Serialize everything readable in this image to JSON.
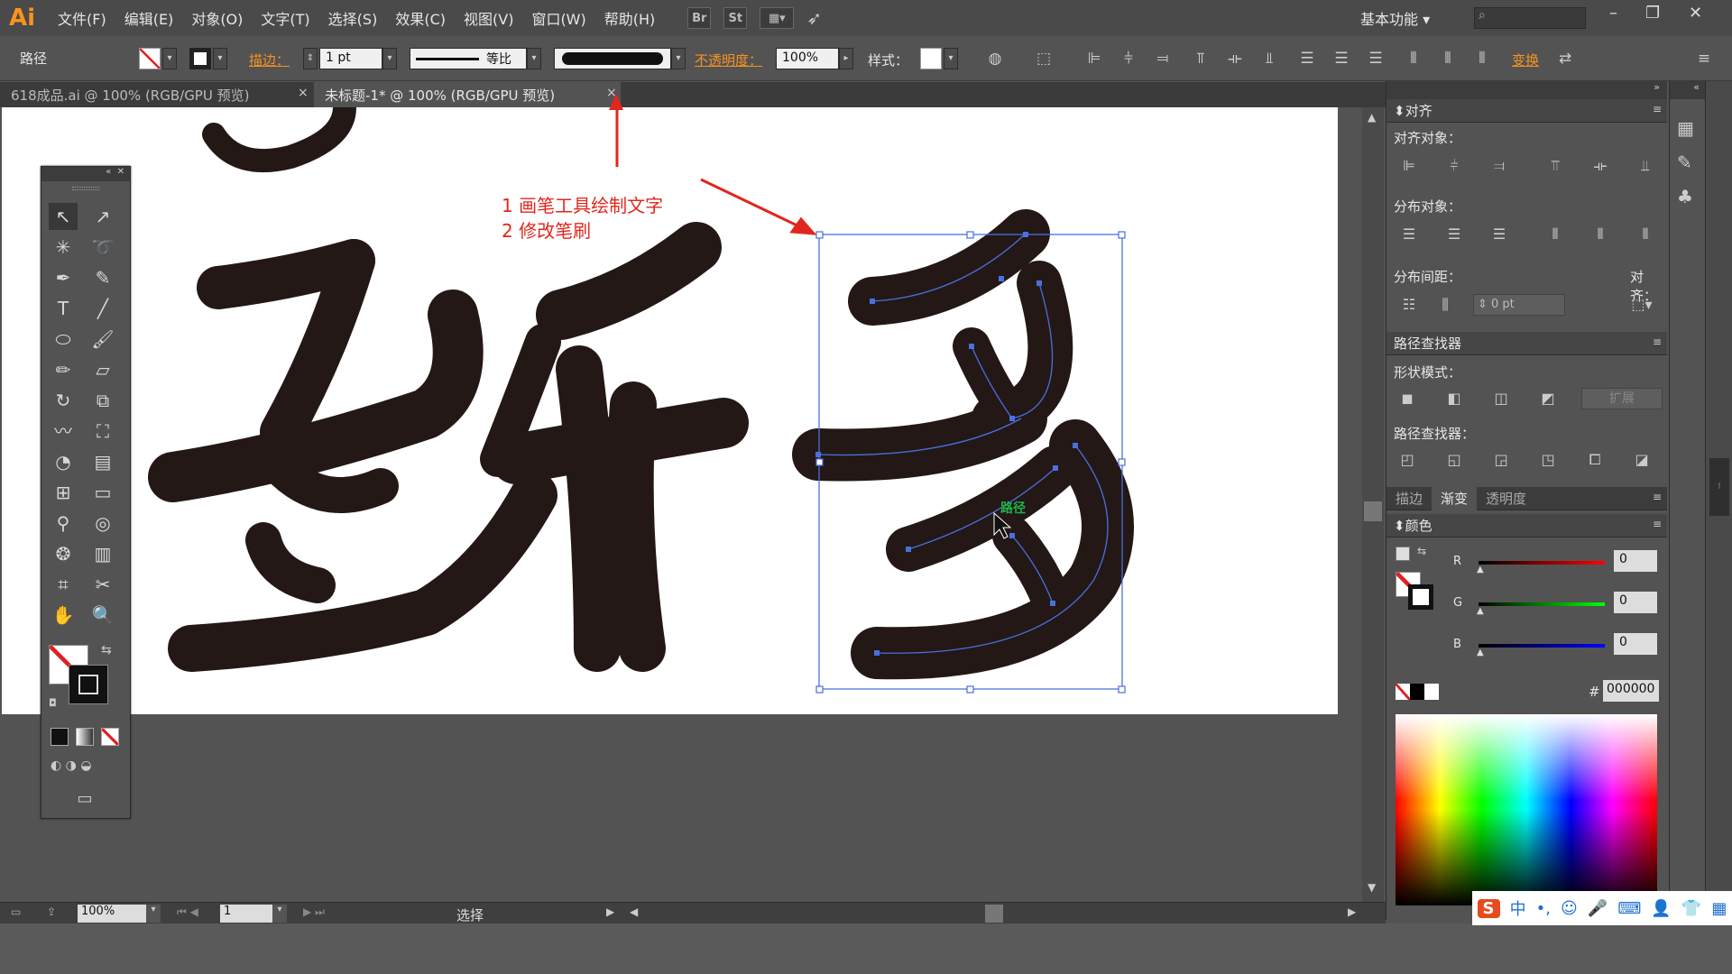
{
  "app": {
    "logo": "Ai"
  },
  "menu": [
    "文件(F)",
    "编辑(E)",
    "对象(O)",
    "文字(T)",
    "选择(S)",
    "效果(C)",
    "视图(V)",
    "窗口(W)",
    "帮助(H)"
  ],
  "menubar_buttons": {
    "br": "Br",
    "st": "St"
  },
  "workspace": "基本功能",
  "controlbar": {
    "object_type": "路径",
    "stroke_label": "描边：",
    "stroke_value": "1 pt",
    "profile_label": "等比",
    "opacity_label": "不透明度：",
    "opacity_value": "100%",
    "style_label": "样式：",
    "transform_label": "变换"
  },
  "tabs": [
    {
      "label": "618成品.ai @ 100% (RGB/GPU 预览)",
      "active": false
    },
    {
      "label": "未标题-1* @ 100% (RGB/GPU 预览)",
      "active": true
    }
  ],
  "annotation": {
    "line1": "1 画笔工具绘制文字",
    "line2": "2 修改笔刷"
  },
  "hover_label": "路径",
  "statusbar": {
    "zoom": "100%",
    "page": "1",
    "mode": "选择"
  },
  "align_panel": {
    "title": "对齐",
    "align_objects": "对齐对象：",
    "distribute_objects": "分布对象：",
    "distribute_spacing": "分布间距：",
    "align_to": "对齐：",
    "spacing_value": "0 pt"
  },
  "pathfinder_panel": {
    "title": "路径查找器",
    "shape_modes": "形状模式：",
    "expand": "扩展",
    "pathfinders": "路径查找器："
  },
  "tabs2": [
    "描边",
    "渐变",
    "透明度"
  ],
  "color_panel": {
    "title": "颜色",
    "r_label": "R",
    "r_value": "0",
    "g_label": "G",
    "g_value": "0",
    "b_label": "B",
    "b_value": "0",
    "hash": "#",
    "hex": "000000"
  },
  "ime": {
    "lang": "中"
  },
  "colors": {
    "accent": "#f7931e",
    "selection": "#4a6fe0",
    "annotation": "#e0271d",
    "glyph": "#231815"
  }
}
